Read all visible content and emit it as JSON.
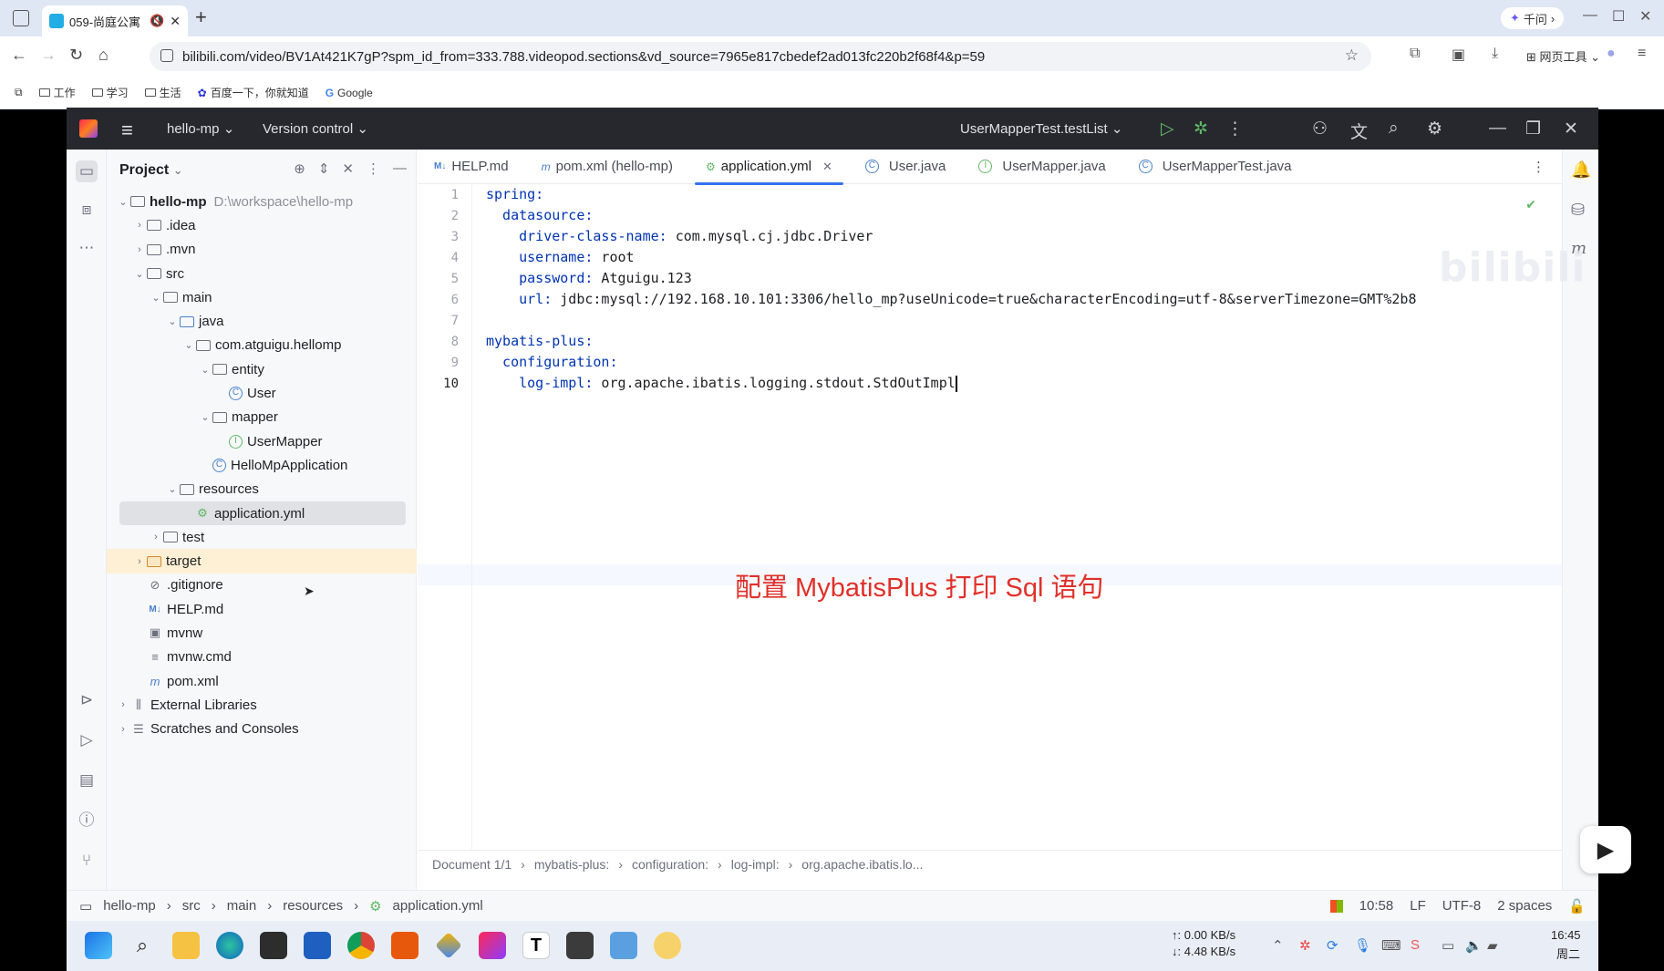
{
  "browser": {
    "tab_title": "059-尚庭公寓",
    "qianwen": "千问",
    "url": "bilibili.com/video/BV1At421K7gP?spm_id_from=333.788.videopod.sections&vd_source=7965e817cbedef2ad013fc220b2f68f4&p=59",
    "webtools": "网页工具",
    "bookmarks": [
      "工作",
      "学习",
      "生活",
      "百度一下，你就知道",
      "Google"
    ]
  },
  "ide": {
    "project_name": "hello-mp",
    "version_control": "Version control",
    "run_config": "UserMapperTest.testList",
    "watermark": "bilibili",
    "project_label": "Project",
    "tree": [
      {
        "label": "hello-mp",
        "path": "D:\\workspace\\hello-mp"
      },
      {
        "label": ".idea"
      },
      {
        "label": ".mvn"
      },
      {
        "label": "src"
      },
      {
        "label": "main"
      },
      {
        "label": "java"
      },
      {
        "label": "com.atguigu.hellomp"
      },
      {
        "label": "entity"
      },
      {
        "label": "User"
      },
      {
        "label": "mapper"
      },
      {
        "label": "UserMapper"
      },
      {
        "label": "HelloMpApplication"
      },
      {
        "label": "resources"
      },
      {
        "label": "application.yml"
      },
      {
        "label": "test"
      },
      {
        "label": "target"
      },
      {
        "label": ".gitignore"
      },
      {
        "label": "HELP.md"
      },
      {
        "label": "mvnw"
      },
      {
        "label": "mvnw.cmd"
      },
      {
        "label": "pom.xml"
      },
      {
        "label": "External Libraries"
      },
      {
        "label": "Scratches and Consoles"
      }
    ],
    "tabs": [
      {
        "label": "HELP.md"
      },
      {
        "label": "pom.xml (hello-mp)"
      },
      {
        "label": "application.yml"
      },
      {
        "label": "User.java"
      },
      {
        "label": "UserMapper.java"
      },
      {
        "label": "UserMapperTest.java"
      }
    ],
    "code_lines": [
      {
        "key": "spring:",
        "rest": ""
      },
      {
        "key": "  datasource:",
        "rest": ""
      },
      {
        "key": "    driver-class-name:",
        "rest": " com.mysql.cj.jdbc.Driver"
      },
      {
        "key": "    username:",
        "rest": " root"
      },
      {
        "key": "    password:",
        "rest": " Atguigu.123"
      },
      {
        "key": "    url:",
        "rest": " jdbc:mysql://192.168.10.101:3306/hello_mp?useUnicode=true&characterEncoding=utf-8&serverTimezone=GMT%2b8"
      },
      {
        "key": "",
        "rest": ""
      },
      {
        "key": "mybatis-plus:",
        "rest": ""
      },
      {
        "key": "  configuration:",
        "rest": ""
      },
      {
        "key": "    log-impl:",
        "rest": " org.apache.ibatis.logging.stdout.StdOutImpl"
      }
    ],
    "line_numbers": [
      "1",
      "2",
      "3",
      "4",
      "5",
      "6",
      "7",
      "8",
      "9",
      "10"
    ],
    "overlay_caption": "配置 MybatisPlus 打印 Sql 语句",
    "breadcrumbs": [
      "Document 1/1",
      "mybatis-plus:",
      "configuration:",
      "log-impl:",
      "org.apache.ibatis.lo..."
    ],
    "status_path": [
      "hello-mp",
      "src",
      "main",
      "resources",
      "application.yml"
    ],
    "status_right": {
      "position": "10:58",
      "line_sep": "LF",
      "encoding": "UTF-8",
      "indent": "2 spaces"
    }
  },
  "taskbar": {
    "net_up": "↑: 0.00 KB/s",
    "net_down": "↓: 4.48 KB/s",
    "time": "16:45",
    "day": "周二"
  },
  "colors": {
    "keyword": "#0033b3",
    "overlay_text": "#e0302a",
    "tab_underline": "#3574f0",
    "ide_title_bg": "#27282e"
  }
}
